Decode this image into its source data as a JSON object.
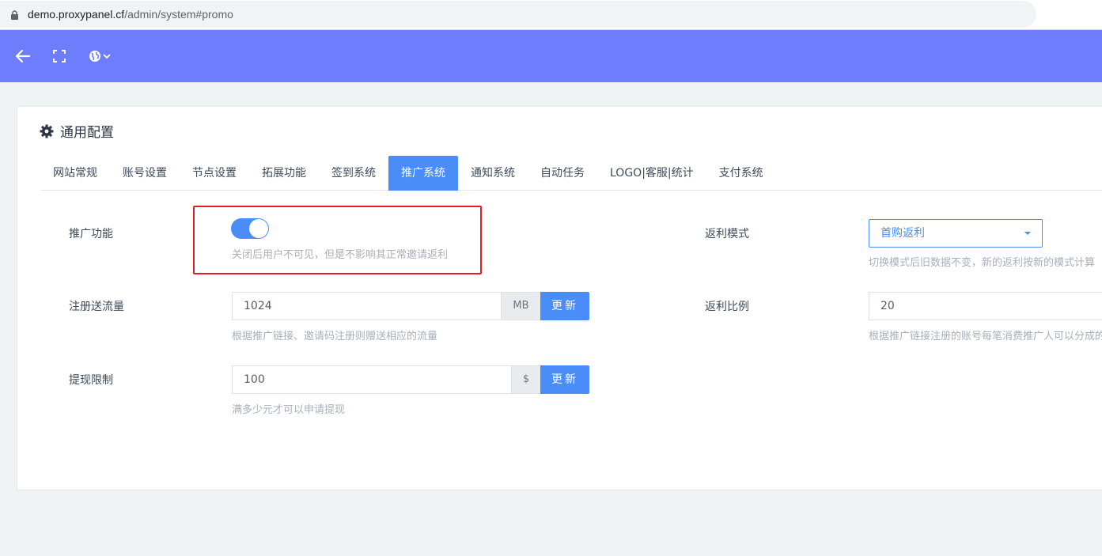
{
  "browser": {
    "url_host": "demo.proxypanel.cf",
    "url_path": "/admin/system#promo"
  },
  "topbar": {
    "back_icon": "arrow-left-icon",
    "fullscreen_icon": "fullscreen-icon",
    "language_icon": "globe-icon"
  },
  "card": {
    "title": "通用配置",
    "tabs": [
      {
        "label": "网站常规"
      },
      {
        "label": "账号设置"
      },
      {
        "label": "节点设置"
      },
      {
        "label": "拓展功能"
      },
      {
        "label": "签到系统"
      },
      {
        "label": "推广系统",
        "active": true
      },
      {
        "label": "通知系统"
      },
      {
        "label": "自动任务"
      },
      {
        "label": "LOGO|客服|统计"
      },
      {
        "label": "支付系统"
      }
    ]
  },
  "promo": {
    "label": "推广功能",
    "enabled": true,
    "help": "关闭后用户不可见，但是不影响其正常邀请返利"
  },
  "register_traffic": {
    "label": "注册送流量",
    "value": "1024",
    "unit": "MB",
    "button": "更新",
    "help": "根据推广链接、邀请码注册则赠送相应的流量"
  },
  "withdraw_limit": {
    "label": "提现限制",
    "value": "100",
    "unit": "$",
    "button": "更新",
    "help": "满多少元才可以申请提现"
  },
  "rebate_mode": {
    "label": "返利模式",
    "selected": "首购返利",
    "help": "切换模式后旧数据不变，新的返利按新的模式计算"
  },
  "rebate_ratio": {
    "label": "返利比例",
    "value": "20",
    "help": "根据推广链接注册的账号每笔消费推广人可以分成的比例"
  },
  "colors": {
    "primary": "#4b8df8",
    "topbar": "#6e7dfb",
    "highlight": "#e02020"
  }
}
